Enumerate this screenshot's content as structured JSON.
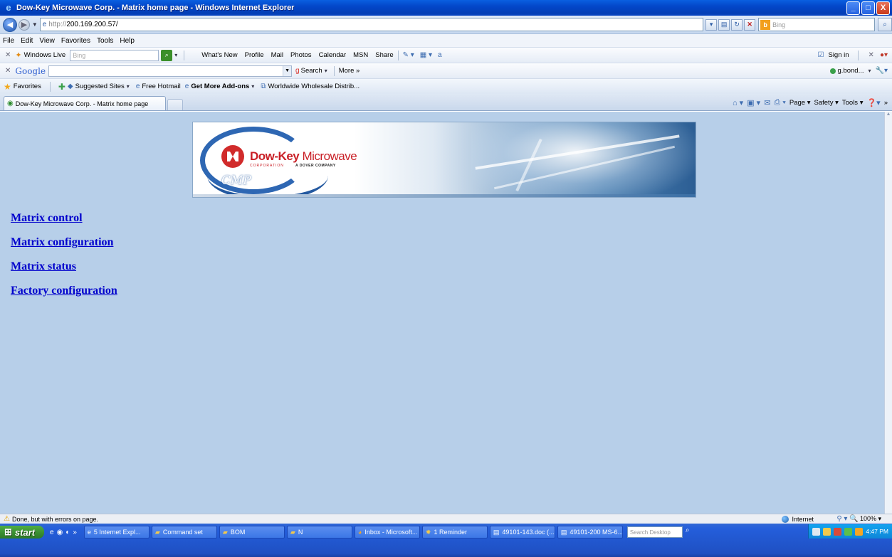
{
  "window": {
    "title": "Dow-Key Microwave Corp. - Matrix home page - Windows Internet Explorer",
    "controls": [
      "_",
      "□",
      "X"
    ]
  },
  "address": {
    "prefix": "http://",
    "host": "200.169.200.57/",
    "search_placeholder": "Bing",
    "search_engine_icon": "b"
  },
  "menu": {
    "items": [
      "File",
      "Edit",
      "View",
      "Favorites",
      "Tools",
      "Help"
    ]
  },
  "live_toolbar": {
    "brand": "Windows Live",
    "search_placeholder": "Bing",
    "links": [
      "What's New",
      "Profile",
      "Mail",
      "Photos",
      "Calendar",
      "MSN",
      "Share"
    ],
    "sign_in": "Sign in"
  },
  "google_toolbar": {
    "logo": "Google",
    "search_label": "Search",
    "more_label": "More »",
    "user": "g.bond..."
  },
  "favorites_bar": {
    "favorites_label": "Favorites",
    "items": [
      "Suggested Sites",
      "Free Hotmail",
      "Get More Add-ons",
      "Worldwide Wholesale Distrib..."
    ]
  },
  "tab": {
    "label": "Dow-Key Microwave Corp. - Matrix home page"
  },
  "command_bar": {
    "page": "Page",
    "safety": "Safety",
    "tools": "Tools"
  },
  "banner": {
    "brand": "Dow-Key",
    "brand_suffix": "Microwave",
    "corporation": "CORPORATION",
    "dover": "A DOVER COMPANY",
    "cmp": "CMP"
  },
  "links": [
    "Matrix control",
    "Matrix configuration",
    "Matrix status",
    "Factory configuration"
  ],
  "status": {
    "text": "Done, but with errors on page.",
    "zone": "Internet",
    "zoom": "100%"
  },
  "taskbar": {
    "start": "start",
    "tasks": [
      {
        "label": "5 Internet Expl...",
        "icon": "ie-icon"
      },
      {
        "label": "Command set",
        "icon": "folder-icon"
      },
      {
        "label": "BOM",
        "icon": "folder-icon"
      },
      {
        "label": "N",
        "icon": "folder-icon"
      },
      {
        "label": "Inbox - Microsoft...",
        "icon": "outlook-icon"
      },
      {
        "label": "1 Reminder",
        "icon": "bell-icon"
      },
      {
        "label": "49101-143.doc (...",
        "icon": "word-icon"
      },
      {
        "label": "49101-200 MS-6...",
        "icon": "word-icon"
      }
    ],
    "search_desktop": "Search Desktop",
    "clock": "4:47 PM"
  }
}
